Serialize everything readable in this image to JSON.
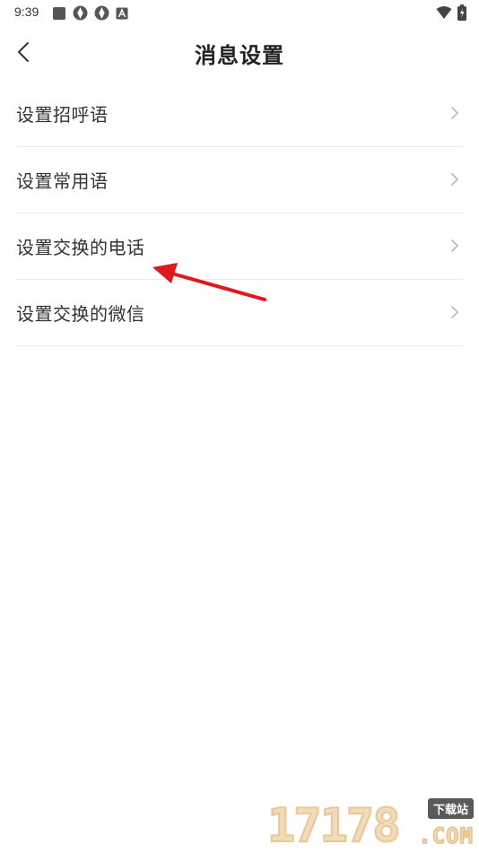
{
  "status_bar": {
    "time": "9:39",
    "icons_left": [
      "square-app-icon",
      "aperture-icon",
      "aperture-icon",
      "a-box-icon"
    ],
    "icons_right": [
      "wifi-icon",
      "battery-charging-icon"
    ]
  },
  "header": {
    "title": "消息设置",
    "back_icon": "chevron-left-icon"
  },
  "menu": {
    "items": [
      {
        "label": "设置招呼语"
      },
      {
        "label": "设置常用语"
      },
      {
        "label": "设置交换的电话"
      },
      {
        "label": "设置交换的微信"
      }
    ]
  },
  "annotation": {
    "type": "arrow",
    "color": "#e0181b",
    "points_to": "设置交换的电话"
  },
  "watermark": {
    "digits": "17178",
    "badge": "下载站",
    "domain": ".COM"
  }
}
